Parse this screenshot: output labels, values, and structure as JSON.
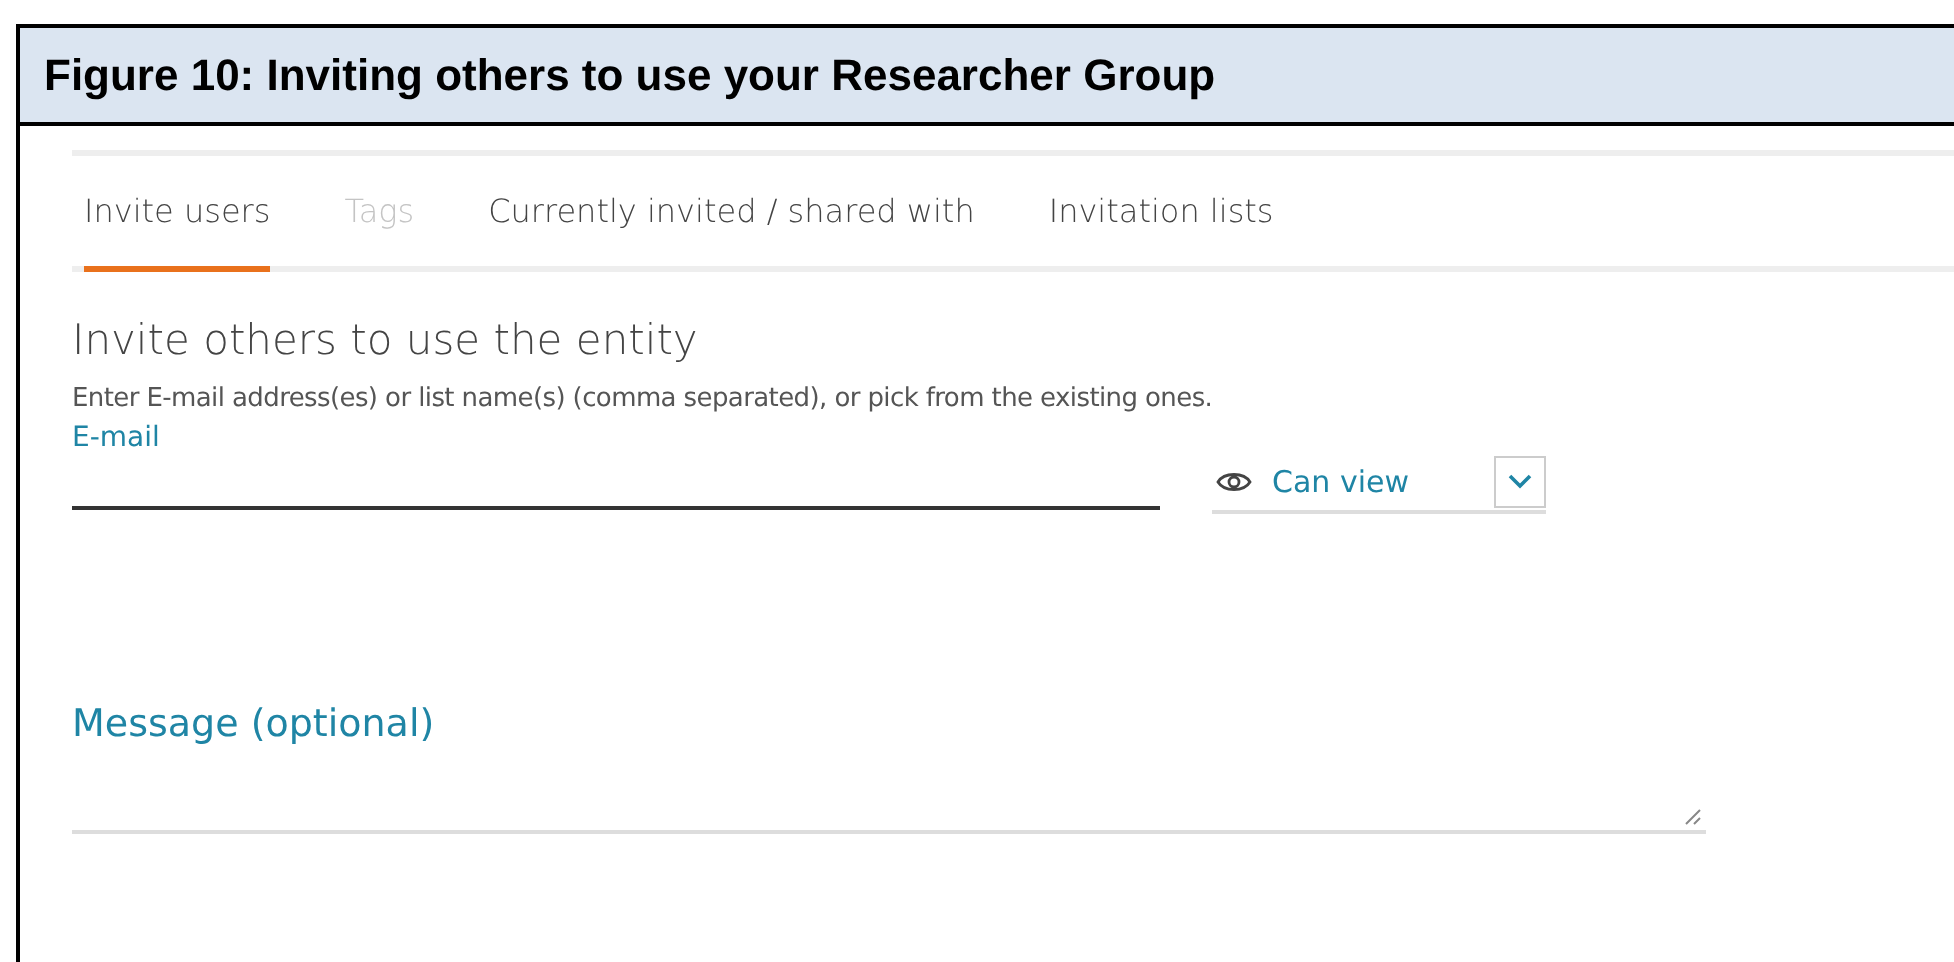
{
  "figure": {
    "title": "Figure 10: Inviting others to use your Researcher Group"
  },
  "tabs": [
    {
      "label": "Invite users",
      "selected": true,
      "disabled": false
    },
    {
      "label": "Tags",
      "selected": false,
      "disabled": true
    },
    {
      "label": "Currently invited / shared with",
      "selected": false,
      "disabled": false
    },
    {
      "label": "Invitation lists",
      "selected": false,
      "disabled": false
    }
  ],
  "heading": "Invite others to use the entity",
  "instructions": "Enter E-mail address(es) or list name(s) (comma separated), or pick from the existing ones.",
  "email": {
    "label": "E-mail"
  },
  "permission": {
    "value": "Can view"
  },
  "message": {
    "label": "Message (optional)"
  }
}
